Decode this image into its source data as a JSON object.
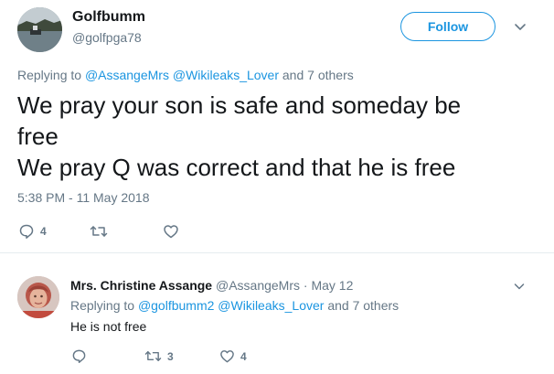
{
  "tweet": {
    "display_name": "Golfbumm",
    "handle": "@golfpga78",
    "follow_label": "Follow",
    "replying_prefix": "Replying to",
    "replying_user1": "@AssangeMrs",
    "replying_user2": "@Wikileaks_Lover",
    "replying_suffix": "and 7 others",
    "text_line1": "We pray your son is safe and someday be",
    "text_line2": "free",
    "text_line3": "We pray Q was correct and that he is free",
    "timestamp": "5:38 PM - 11 May 2018",
    "reply_count": "4",
    "retweet_count": "",
    "like_count": ""
  },
  "reply": {
    "display_name": "Mrs. Christine Assange",
    "handle": "@AssangeMrs",
    "separator": "·",
    "date": "May 12",
    "replying_prefix": "Replying to",
    "replying_user1": "@golfbumm2",
    "replying_user2": "@Wikileaks_Lover",
    "replying_suffix": "and 7 others",
    "text": "He is not free",
    "reply_count": "",
    "retweet_count": "3",
    "like_count": "4"
  },
  "icons": {
    "reply": "reply-icon",
    "retweet": "retweet-icon",
    "like": "heart-icon",
    "more": "chevron-down-icon"
  },
  "colors": {
    "accent": "#1b95e0",
    "muted": "#657786",
    "text": "#14171a",
    "divider": "#e6ecf0"
  }
}
